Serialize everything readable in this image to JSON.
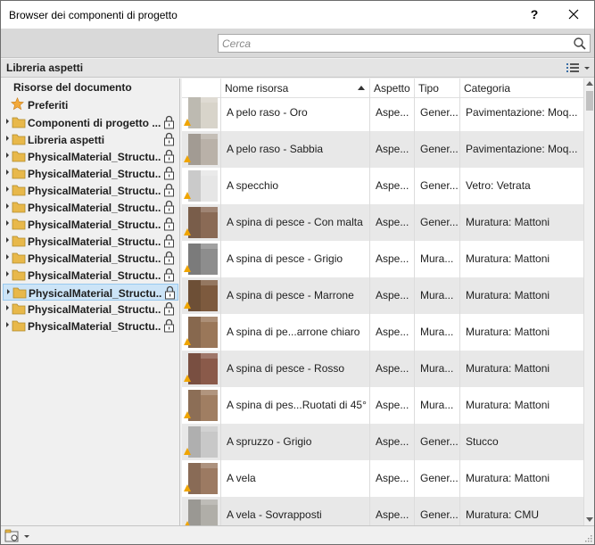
{
  "window": {
    "title": "Browser dei componenti di progetto",
    "help_label": "?"
  },
  "search": {
    "placeholder": "Cerca",
    "value": ""
  },
  "library_bar": {
    "title": "Libreria aspetti"
  },
  "tree": {
    "root_label": "Risorse del documento",
    "favorites_label": "Preferiti",
    "items": [
      {
        "label": "Componenti di progetto ...",
        "locked": true,
        "selected": false
      },
      {
        "label": "Libreria aspetti",
        "locked": true,
        "selected": false
      },
      {
        "label": "PhysicalMaterial_Structu...",
        "locked": true,
        "selected": false
      },
      {
        "label": "PhysicalMaterial_Structu...",
        "locked": true,
        "selected": false
      },
      {
        "label": "PhysicalMaterial_Structu...",
        "locked": true,
        "selected": false
      },
      {
        "label": "PhysicalMaterial_Structu...",
        "locked": true,
        "selected": false
      },
      {
        "label": "PhysicalMaterial_Structu...",
        "locked": true,
        "selected": false
      },
      {
        "label": "PhysicalMaterial_Structu...",
        "locked": true,
        "selected": false
      },
      {
        "label": "PhysicalMaterial_Structu...",
        "locked": true,
        "selected": false
      },
      {
        "label": "PhysicalMaterial_Structu...",
        "locked": true,
        "selected": false
      },
      {
        "label": "PhysicalMaterial_Structu...",
        "locked": true,
        "selected": true
      },
      {
        "label": "PhysicalMaterial_Structu...",
        "locked": true,
        "selected": false
      },
      {
        "label": "PhysicalMaterial_Structu...",
        "locked": true,
        "selected": false
      }
    ]
  },
  "table": {
    "columns": [
      "Nome risorsa",
      "Aspetto",
      "Tipo",
      "Categoria"
    ],
    "sorted_column": "Nome risorsa",
    "rows": [
      {
        "name": "A pelo raso - Oro",
        "aspetto": "Aspe...",
        "tipo": "Gener...",
        "categoria": "Pavimentazione: Moq...",
        "swatch": "#d8d4ca"
      },
      {
        "name": "A pelo raso - Sabbia",
        "aspetto": "Aspe...",
        "tipo": "Gener...",
        "categoria": "Pavimentazione: Moq...",
        "swatch": "#b9b1a8"
      },
      {
        "name": "A specchio",
        "aspetto": "Aspe...",
        "tipo": "Gener...",
        "categoria": "Vetro: Vetrata",
        "swatch": "#e6e6e6"
      },
      {
        "name": "A spina di pesce - Con malta",
        "aspetto": "Aspe...",
        "tipo": "Gener...",
        "categoria": "Muratura: Mattoni",
        "swatch": "#8a6a55"
      },
      {
        "name": "A spina di pesce - Grigio",
        "aspetto": "Aspe...",
        "tipo": "Mura...",
        "categoria": "Muratura: Mattoni",
        "swatch": "#8d8d8d"
      },
      {
        "name": "A spina di pesce - Marrone",
        "aspetto": "Aspe...",
        "tipo": "Mura...",
        "categoria": "Muratura: Mattoni",
        "swatch": "#7d5a3e"
      },
      {
        "name": "A spina di pe...arrone chiaro",
        "aspetto": "Aspe...",
        "tipo": "Mura...",
        "categoria": "Muratura: Mattoni",
        "swatch": "#9a7759"
      },
      {
        "name": "A spina di pesce - Rosso",
        "aspetto": "Aspe...",
        "tipo": "Mura...",
        "categoria": "Muratura: Mattoni",
        "swatch": "#8a5a4a"
      },
      {
        "name": "A spina di pes...Ruotati di 45°",
        "aspetto": "Aspe...",
        "tipo": "Mura...",
        "categoria": "Muratura: Mattoni",
        "swatch": "#a07e62"
      },
      {
        "name": "A spruzzo - Grigio",
        "aspetto": "Aspe...",
        "tipo": "Gener...",
        "categoria": "Stucco",
        "swatch": "#c8c8c8"
      },
      {
        "name": "A vela",
        "aspetto": "Aspe...",
        "tipo": "Gener...",
        "categoria": "Muratura: Mattoni",
        "swatch": "#9c7a62"
      },
      {
        "name": "A vela - Sovrapposti",
        "aspetto": "Aspe...",
        "tipo": "Gener...",
        "categoria": "Muratura: CMU",
        "swatch": "#b0aea8"
      }
    ]
  },
  "colors": {
    "selection": "#cce4f7",
    "folder": "#e8b84a",
    "star": "#f2a93b",
    "row_alt": "#e8e8e8",
    "warning": "#f0a500"
  }
}
